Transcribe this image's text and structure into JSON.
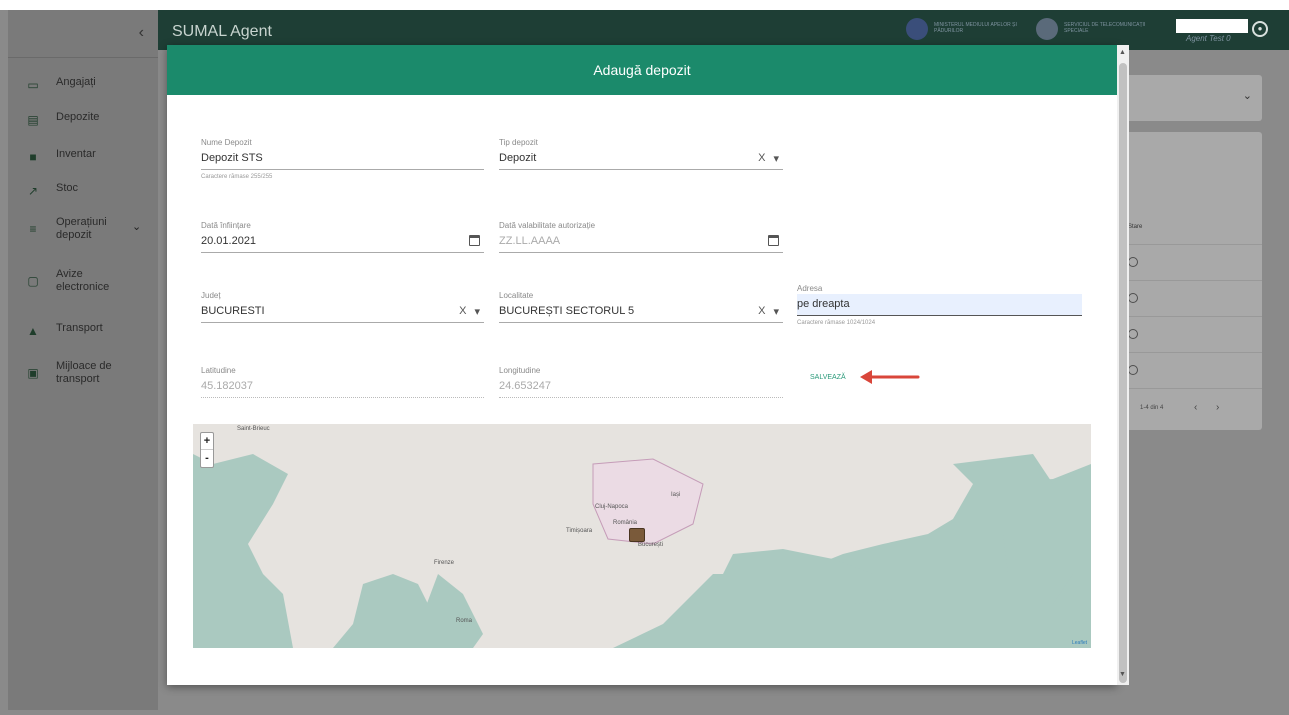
{
  "app": {
    "title": "SUMAL Agent"
  },
  "header": {
    "ministry_text": "MINISTERUL MEDIULUI APELOR ȘI PĂDURILOR",
    "sts_text": "SERVICIUL DE TELECOMUNICAȚII SPECIALE",
    "user_name": "Agent Test 0"
  },
  "sidebar": {
    "collapse_icon": "chevron-left-icon",
    "items": [
      {
        "label": "Angajați",
        "icon": "briefcase-icon"
      },
      {
        "label": "Depozite",
        "icon": "warehouse-icon"
      },
      {
        "label": "Inventar",
        "icon": "inventory-icon"
      },
      {
        "label": "Stoc",
        "icon": "trend-icon"
      },
      {
        "label": "Operațiuni depozit",
        "icon": "list-icon"
      },
      {
        "label": "Avize electronice",
        "icon": "document-icon"
      },
      {
        "label": "Transport",
        "icon": "route-icon"
      },
      {
        "label": "Mijloace de transport",
        "icon": "truck-icon"
      }
    ]
  },
  "modal": {
    "title": "Adaugă depozit",
    "fields": {
      "nume_depozit": {
        "label": "Nume Depozit",
        "value": "Depozit STS",
        "hint": "Caractere rămase 255/255"
      },
      "tip_depozit": {
        "label": "Tip depozit",
        "value": "Depozit"
      },
      "data_infiintare": {
        "label": "Dată înființare",
        "value": "20.01.2021"
      },
      "data_valabilitate": {
        "label": "Dată valabilitate autorizație",
        "placeholder": "ZZ.LL.AAAA"
      },
      "judet": {
        "label": "Județ",
        "value": "BUCURESTI"
      },
      "localitate": {
        "label": "Localitate",
        "value": "BUCUREȘTI SECTORUL 5"
      },
      "adresa": {
        "label": "Adresa",
        "value": "pe dreapta",
        "hint": "Caractere rămase 1024/1024"
      },
      "latitudine": {
        "label": "Latitudine",
        "value": "45.182037"
      },
      "longitudine": {
        "label": "Longitudine",
        "value": "24.653247"
      }
    },
    "clear_glyph": "X",
    "save_label": "SALVEAZĂ"
  },
  "map": {
    "zoom_in": "+",
    "zoom_out": "-",
    "labels": {
      "cluj": "Cluj-Napoca",
      "romania": "România",
      "iasi": "Iași",
      "timisoara": "Timișoara",
      "bucuresti": "București",
      "firenze": "Firenze",
      "roma": "Roma",
      "saint": "Saint-Brieuc"
    },
    "attribution": "Leaflet"
  },
  "background_table": {
    "header_cell": "Stare",
    "pagination": "1-4 din 4"
  },
  "colors": {
    "header_bg": "#1e3e35",
    "modal_header": "#1b8a6b",
    "save_accent": "#2a9a7a"
  }
}
